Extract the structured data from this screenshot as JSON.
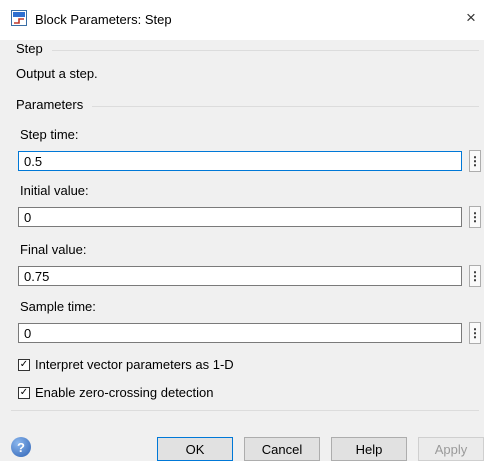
{
  "window": {
    "title": "Block Parameters: Step",
    "app_icon": "simulink-block-icon",
    "close_label": "×"
  },
  "block_group": {
    "title": "Step",
    "description": "Output a step."
  },
  "parameters_group": {
    "title": "Parameters",
    "fields": [
      {
        "label": "Step time:",
        "value": "0.5",
        "focused": true
      },
      {
        "label": "Initial value:",
        "value": "0"
      },
      {
        "label": "Final value:",
        "value": "0.75"
      },
      {
        "label": "Sample time:",
        "value": "0"
      }
    ],
    "field_menu_glyph": "⋮",
    "checkboxes": [
      {
        "label": "Interpret vector parameters as 1-D",
        "checked": true,
        "glyph": "✓"
      },
      {
        "label": "Enable zero-crossing detection",
        "checked": true,
        "glyph": "✓"
      }
    ]
  },
  "footer": {
    "help_glyph": "?",
    "buttons": {
      "ok": "OK",
      "cancel": "Cancel",
      "help": "Help",
      "apply": "Apply"
    }
  },
  "colors": {
    "focus_border": "#0078d7",
    "dialog_background": "#f0f0f0"
  }
}
